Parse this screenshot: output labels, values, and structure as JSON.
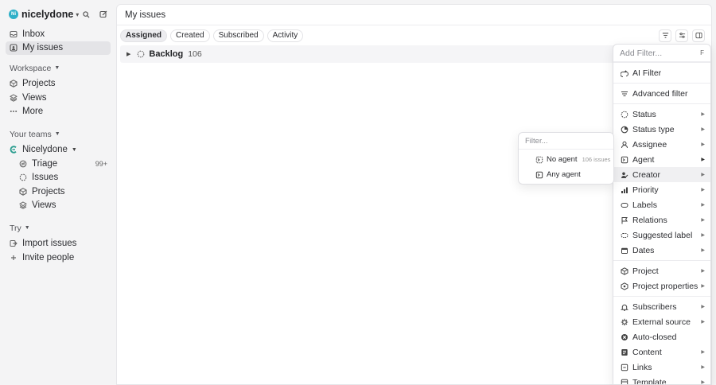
{
  "workspace": {
    "avatar_initials": "Ni",
    "name": "nicelydone"
  },
  "sidebar": {
    "top_items": [
      {
        "label": "Inbox",
        "icon": "inbox-icon"
      },
      {
        "label": "My issues",
        "icon": "my-issues-icon",
        "active": true
      }
    ],
    "workspace_label": "Workspace",
    "workspace_items": [
      {
        "label": "Projects",
        "icon": "projects-icon"
      },
      {
        "label": "Views",
        "icon": "views-icon"
      },
      {
        "label": "More",
        "icon": "more-icon"
      }
    ],
    "teams_label": "Your teams",
    "team_name": "Nicelydone",
    "team_items": [
      {
        "label": "Triage",
        "icon": "triage-icon",
        "count": "99+"
      },
      {
        "label": "Issues",
        "icon": "issues-icon"
      },
      {
        "label": "Projects",
        "icon": "projects-icon"
      },
      {
        "label": "Views",
        "icon": "views-icon"
      }
    ],
    "try_label": "Try",
    "try_items": [
      {
        "label": "Import issues",
        "icon": "import-icon"
      },
      {
        "label": "Invite people",
        "icon": "plus-icon"
      }
    ]
  },
  "main": {
    "title": "My issues",
    "tabs": [
      "Assigned",
      "Created",
      "Subscribed",
      "Activity"
    ],
    "active_tab": "Assigned",
    "group": {
      "name": "Backlog",
      "count": "106"
    }
  },
  "filter_menu": {
    "placeholder": "Add Filter...",
    "shortcut": "F",
    "ai_filter": "AI Filter",
    "advanced_filter": "Advanced filter",
    "items_a": [
      "Status",
      "Status type",
      "Assignee",
      "Agent",
      "Creator",
      "Priority",
      "Labels",
      "Relations",
      "Suggested label",
      "Dates"
    ],
    "items_b": [
      "Project",
      "Project properties"
    ],
    "items_c": [
      "Subscribers",
      "External source",
      "Auto-closed",
      "Content",
      "Links",
      "Template"
    ],
    "highlighted": "Creator"
  },
  "agent_submenu": {
    "placeholder": "Filter...",
    "no_agent": "No agent",
    "no_agent_hint": "106 issues",
    "any_agent": "Any agent"
  },
  "colors": {
    "workspace_avatar": "#2fb0c8",
    "team_icon": "#2a9d8f"
  }
}
